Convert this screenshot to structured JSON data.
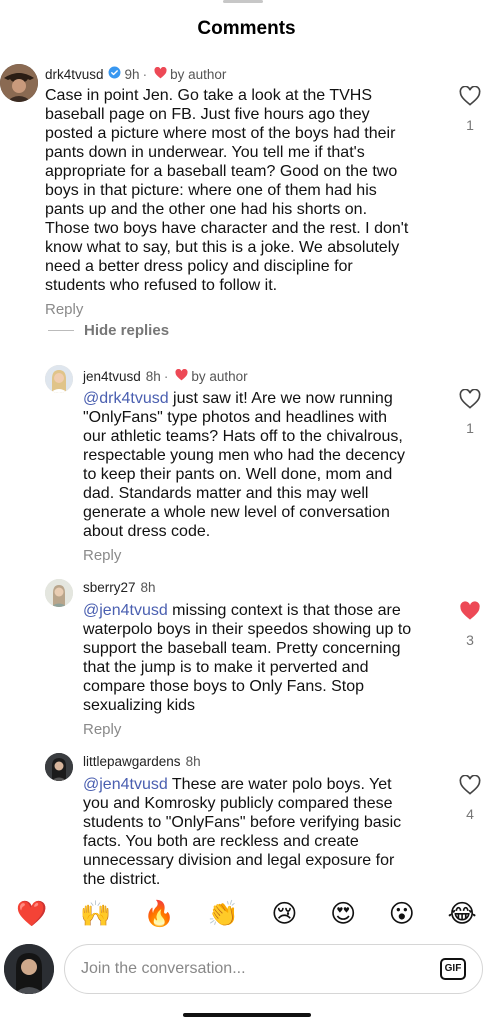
{
  "header": {
    "title": "Comments"
  },
  "comments": [
    {
      "username": "drk4tvusd",
      "verified": true,
      "time": "9h",
      "sep": "·",
      "by_author": "by author",
      "text": "Case in point Jen. Go take a look at the TVHS baseball page on FB.  Just five hours ago they posted a picture where most of the boys had their pants down in underwear. You tell me if that's appropriate for a baseball team? Good on the two boys in that picture: where one of them had his pants up and the other one had his shorts on. Those two boys have character and the rest. I don't know what to say, but this is a joke. We absolutely need a better dress policy and discipline for students who refused to follow it.",
      "lines": [
        "Case in point Jen. Go take a look at the TVHS",
        "baseball page on FB.  Just five hours ago they",
        "posted a picture where most of the boys had their",
        "pants down in underwear. You tell me if that's",
        "appropriate for a baseball team? Good on the two",
        "boys in that picture: where one of them had his",
        "pants up and the other one had his shorts on.",
        "Those two boys have character and the rest. I don't",
        "know what to say, but this is a joke. We absolutely",
        "need a better dress policy and discipline for",
        "students who refused to follow it."
      ],
      "reply_label": "Reply",
      "likes": "1",
      "liked": false
    },
    {
      "username": "jen4tvusd",
      "time": "8h",
      "sep": "·",
      "by_author": "by author",
      "mention": "@drk4tvusd",
      "lines": [
        " just saw it! Are we now running",
        "\"OnlyFans\" type photos and headlines with",
        "our athletic teams? Hats off to the chivalrous,",
        "respectable young men who had the decency",
        "to keep their pants on. Well done, mom and",
        "dad. Standards matter and this may well",
        "generate a whole new level of conversation",
        "about dress code."
      ],
      "reply_label": "Reply",
      "likes": "1",
      "liked": false
    },
    {
      "username": "sberry27",
      "time": "8h",
      "mention": "@jen4tvusd",
      "lines": [
        " missing context is that those are",
        "waterpolo boys in their speedos showing up to",
        "support the baseball team. Pretty concerning",
        "that the jump is to make it perverted and",
        "compare those boys to Only Fans. Stop",
        "sexualizing kids"
      ],
      "reply_label": "Reply",
      "likes": "3",
      "liked": true
    },
    {
      "username": "littlepawgardens",
      "time": "8h",
      "mention": "@jen4tvusd",
      "lines": [
        " These are water polo boys. Yet",
        "you and Komrosky publicly compared these",
        "students to \"OnlyFans\" before verifying basic",
        "facts. You both are reckless and create",
        "unnecessary division and legal exposure for",
        "the district."
      ],
      "likes": "4",
      "liked": false
    }
  ],
  "hide_replies_label": "Hide replies",
  "emoji_bar": [
    "❤️",
    "🙌",
    "🔥",
    "👏",
    "😢",
    "😍",
    "😮",
    "😂"
  ],
  "composer": {
    "placeholder": "Join the conversation...",
    "gif_label": "GIF"
  },
  "colors": {
    "heart_red": "#ed4956",
    "mention": "#4a5fb0",
    "verified_blue": "#3897f0"
  }
}
